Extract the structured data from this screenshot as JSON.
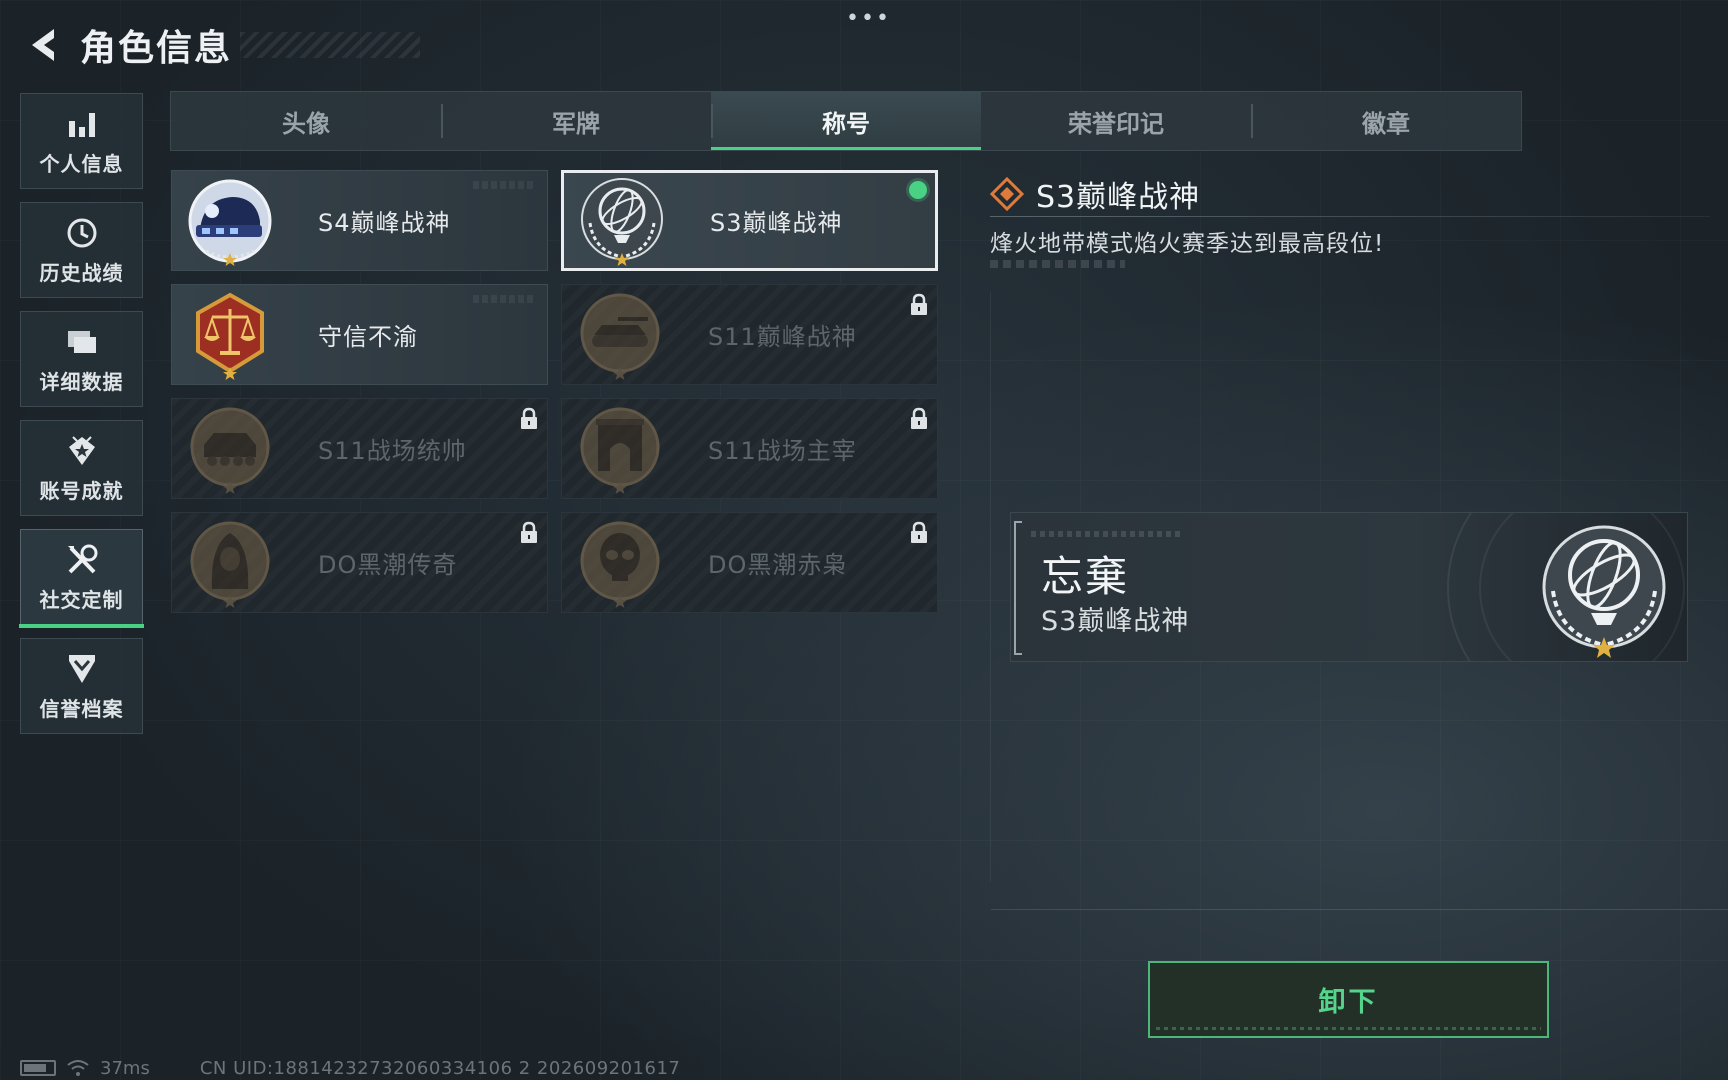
{
  "header": {
    "title": "角色信息",
    "menu_dots": "•••"
  },
  "sidebar": {
    "items": [
      {
        "label": "个人信息",
        "icon": "bar-chart-icon",
        "active": false
      },
      {
        "label": "历史战绩",
        "icon": "clock-history-icon",
        "active": false
      },
      {
        "label": "详细数据",
        "icon": "folders-icon",
        "active": false
      },
      {
        "label": "账号成就",
        "icon": "achievement-star-icon",
        "active": false
      },
      {
        "label": "社交定制",
        "icon": "tools-icon",
        "active": true
      },
      {
        "label": "信誉档案",
        "icon": "shield-chevron-icon",
        "active": false
      }
    ]
  },
  "tabs": [
    {
      "label": "头像",
      "active": false
    },
    {
      "label": "军牌",
      "active": false
    },
    {
      "label": "称号",
      "active": true
    },
    {
      "label": "荣誉印记",
      "active": false
    },
    {
      "label": "徽章",
      "active": false
    }
  ],
  "titles": [
    {
      "label": "S4巅峰战神",
      "emblem": "helmet-emblem-icon",
      "locked": false,
      "selected": false,
      "equipped": false
    },
    {
      "label": "S3巅峰战神",
      "emblem": "armillary-globe-emblem-icon",
      "locked": false,
      "selected": true,
      "equipped": true
    },
    {
      "label": "守信不渝",
      "emblem": "scales-emblem-icon",
      "locked": false,
      "selected": false,
      "equipped": false
    },
    {
      "label": "S11巅峰战神",
      "emblem": "tank-emblem-icon",
      "locked": true,
      "selected": false,
      "equipped": false
    },
    {
      "label": "S11战场统帅",
      "emblem": "apc-emblem-icon",
      "locked": true,
      "selected": false,
      "equipped": false
    },
    {
      "label": "S11战场主宰",
      "emblem": "arch-emblem-icon",
      "locked": true,
      "selected": false,
      "equipped": false
    },
    {
      "label": "DO黑潮传奇",
      "emblem": "hooded-figure-emblem-icon",
      "locked": true,
      "selected": false,
      "equipped": false
    },
    {
      "label": "DO黑潮赤枭",
      "emblem": "skull-emblem-icon",
      "locked": true,
      "selected": false,
      "equipped": false
    }
  ],
  "detail": {
    "title": "S3巅峰战神",
    "description": "烽火地带模式焰火赛季达到最高段位!",
    "title_icon": "diamond-rank-icon"
  },
  "preview": {
    "player_name": "忘棄",
    "title": "S3巅峰战神",
    "emblem": "armillary-globe-emblem-icon"
  },
  "action": {
    "unequip_label": "卸下"
  },
  "status_bar": {
    "latency": "37ms",
    "uid": "CN UID:18814232732060334106 2 202609201617"
  },
  "colors": {
    "accent_green": "#49d184",
    "background": "#1b2329",
    "title_icon_orange": "#e07a3a",
    "emblem_gold": "#e0b040",
    "emblem_red": "#9c2f22"
  }
}
